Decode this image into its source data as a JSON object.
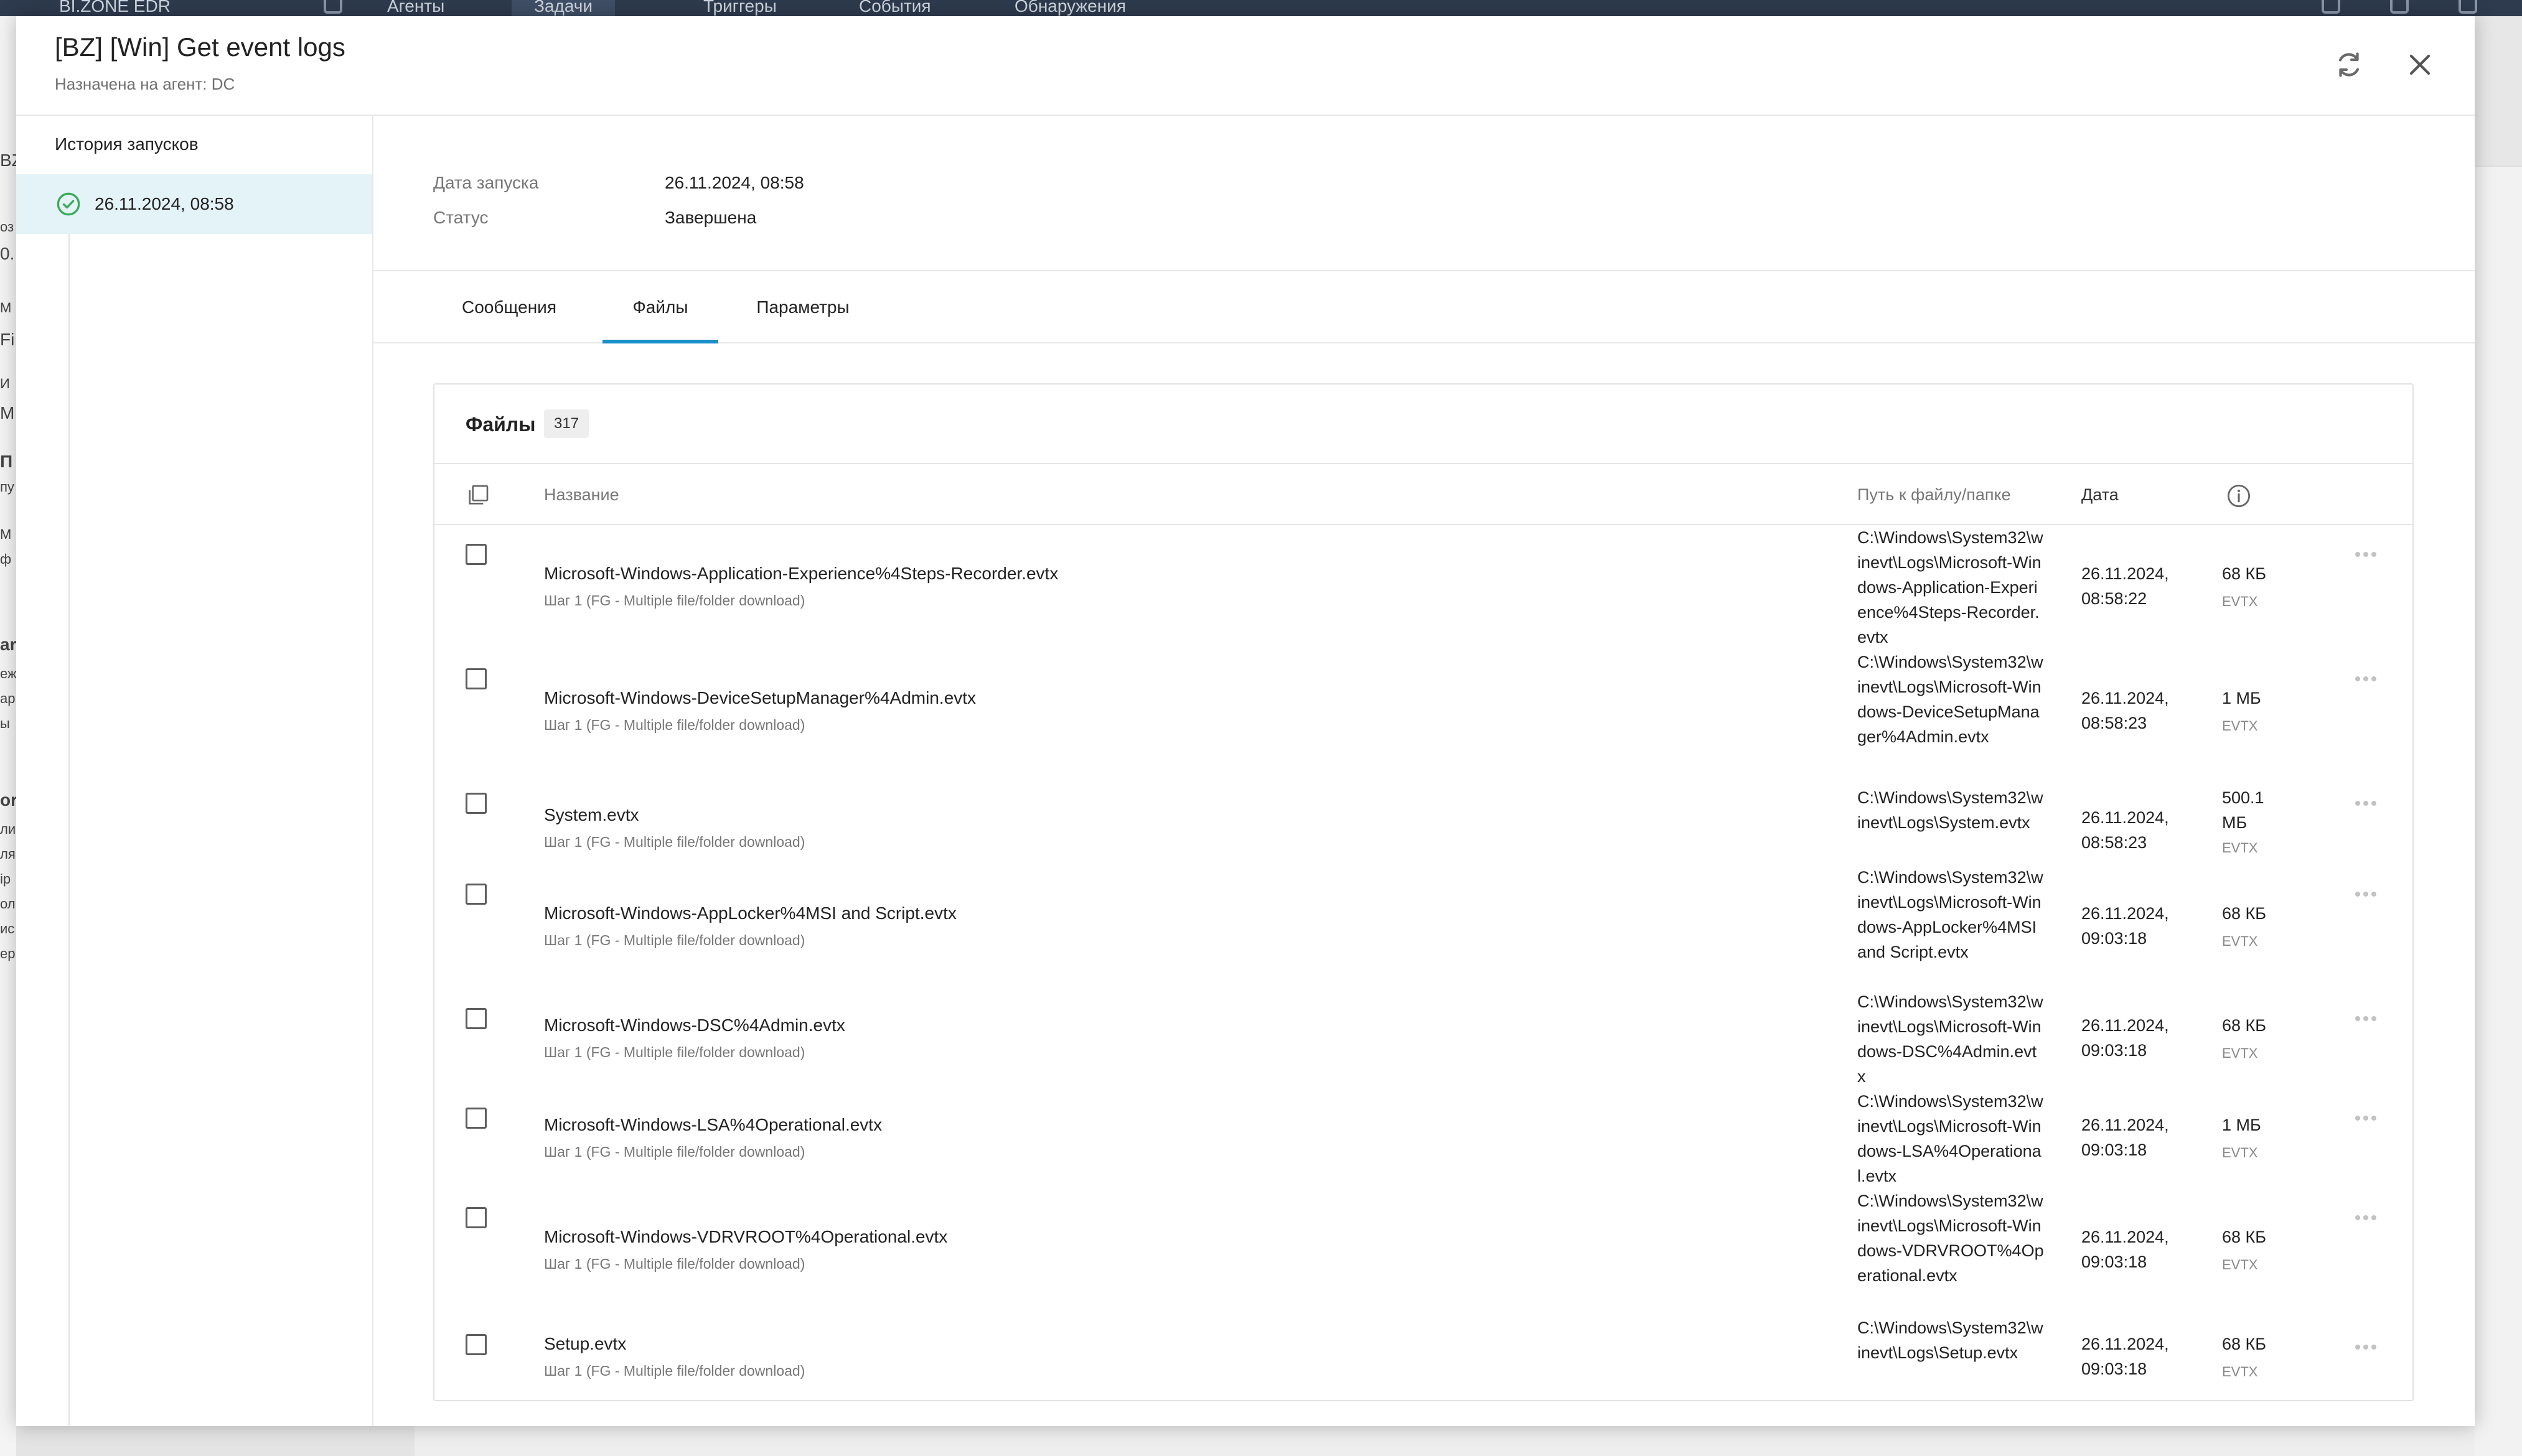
{
  "app": {
    "brand": "BI.ZONE EDR",
    "nav": [
      "Агенты",
      "Задачи",
      "Триггеры",
      "События",
      "Обнаружения"
    ],
    "left_fragments": [
      "BZ",
      "оз",
      "0.",
      "М",
      "Fi",
      "И",
      "М",
      "П",
      "пу",
      "М",
      "ф",
      "ar",
      "еж",
      "ap",
      "ы",
      "or",
      "ли",
      "ля",
      "ip",
      "ол",
      "ис",
      "ер"
    ]
  },
  "modal": {
    "title": "[BZ] [Win] Get event logs",
    "subtitle": "Назначена на агент: DC"
  },
  "sidebar": {
    "title": "История запусков",
    "runs": [
      {
        "label": "26.11.2024, 08:58",
        "status": "success"
      }
    ]
  },
  "details": {
    "start_label": "Дата запуска",
    "start_value": "26.11.2024, 08:58",
    "status_label": "Статус",
    "status_value": "Завершена"
  },
  "tabs": [
    {
      "label": "Сообщения",
      "active": false
    },
    {
      "label": "Файлы",
      "active": true
    },
    {
      "label": "Параметры",
      "active": false
    }
  ],
  "files": {
    "title": "Файлы",
    "count": "317",
    "columns": {
      "name": "Название",
      "path": "Путь к файлу/папке",
      "date": "Дата"
    },
    "rows": [
      {
        "name": "Microsoft-Windows-Application-Experience%4Steps-Recorder.evtx",
        "step": "Шаг 1 (FG - Multiple file/folder download)",
        "path": "C:\\Windows\\System32\\winevt\\Logs\\Microsoft-Windows-Application-Experience%4Steps-Recorder.evtx",
        "date": "26.11.2024, 08:58:22",
        "size": "68 КБ",
        "type": "EVTX"
      },
      {
        "name": "Microsoft-Windows-DeviceSetupManager%4Admin.evtx",
        "step": "Шаг 1 (FG - Multiple file/folder download)",
        "path": "C:\\Windows\\System32\\winevt\\Logs\\Microsoft-Windows-DeviceSetupManager%4Admin.evtx",
        "date": "26.11.2024, 08:58:23",
        "size": "1 МБ",
        "type": "EVTX"
      },
      {
        "name": "System.evtx",
        "step": "Шаг 1 (FG - Multiple file/folder download)",
        "path": "C:\\Windows\\System32\\winevt\\Logs\\System.evtx",
        "date": "26.11.2024, 08:58:23",
        "size": "500.1 МБ",
        "type": "EVTX"
      },
      {
        "name": "Microsoft-Windows-AppLocker%4MSI and Script.evtx",
        "step": "Шаг 1 (FG - Multiple file/folder download)",
        "path": "C:\\Windows\\System32\\winevt\\Logs\\Microsoft-Windows-AppLocker%4MSI and Script.evtx",
        "date": "26.11.2024, 09:03:18",
        "size": "68 КБ",
        "type": "EVTX"
      },
      {
        "name": "Microsoft-Windows-DSC%4Admin.evtx",
        "step": "Шаг 1 (FG - Multiple file/folder download)",
        "path": "C:\\Windows\\System32\\winevt\\Logs\\Microsoft-Windows-DSC%4Admin.evtx",
        "date": "26.11.2024, 09:03:18",
        "size": "68 КБ",
        "type": "EVTX"
      },
      {
        "name": "Microsoft-Windows-LSA%4Operational.evtx",
        "step": "Шаг 1 (FG - Multiple file/folder download)",
        "path": "C:\\Windows\\System32\\winevt\\Logs\\Microsoft-Windows-LSA%4Operational.evtx",
        "date": "26.11.2024, 09:03:18",
        "size": "1 МБ",
        "type": "EVTX"
      },
      {
        "name": "Microsoft-Windows-VDRVROOT%4Operational.evtx",
        "step": "Шаг 1 (FG - Multiple file/folder download)",
        "path": "C:\\Windows\\System32\\winevt\\Logs\\Microsoft-Windows-VDRVROOT%4Operational.evtx",
        "date": "26.11.2024, 09:03:18",
        "size": "68 КБ",
        "type": "EVTX"
      },
      {
        "name": "Setup.evtx",
        "step": "Шаг 1 (FG - Multiple file/folder download)",
        "path": "C:\\Windows\\System32\\winevt\\Logs\\Setup.evtx",
        "date": "26.11.2024, 09:03:18",
        "size": "68 КБ",
        "type": "EVTX"
      }
    ]
  },
  "icons": {
    "refresh": "refresh-icon",
    "close": "close-icon",
    "success": "check-circle-icon",
    "select_all": "copy-icon",
    "info": "info-icon",
    "more": "more-horizontal-icon"
  },
  "colors": {
    "accent": "#1a8fc9",
    "success": "#3aaa5a",
    "selected_row": "#e4f3f7",
    "topbar": "#2e3b4e"
  }
}
